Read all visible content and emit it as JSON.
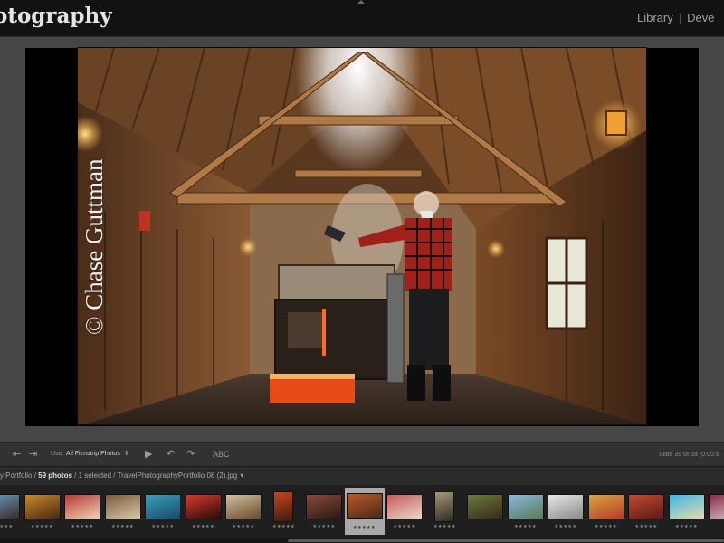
{
  "identity_plate": "otography",
  "modules": [
    {
      "label": "Library"
    },
    {
      "label": "Deve"
    }
  ],
  "slide": {
    "watermark": "© Chase Guttman"
  },
  "toolbar": {
    "use_label": "Use:",
    "use_value": "All Filmstrip Photos",
    "text_tool": "ABC",
    "slide_counter": "Slide 39 of 59 (0:05:5"
  },
  "filmstrip_header": {
    "collection": "phy Portfolio",
    "separator": " / ",
    "photo_count": "59 photos",
    "selection": " / 1 selected / ",
    "filename": "TravelPhotographyPortfolio 08 (2).jpg",
    "dropdown": "▾"
  },
  "filmstrip": {
    "stars": "★★★★★",
    "thumbs": [
      {
        "colors": [
          "#6aa0c8",
          "#3a2a22"
        ],
        "stars": true
      },
      {
        "colors": [
          "#c9882a",
          "#4a2a14"
        ],
        "stars": true
      },
      {
        "colors": [
          "#b53a3a",
          "#f0d0b0"
        ],
        "stars": true
      },
      {
        "colors": [
          "#7a5a3a",
          "#d8c8a8"
        ],
        "stars": true
      },
      {
        "colors": [
          "#3aa0b8",
          "#1a4a6a"
        ],
        "stars": true
      },
      {
        "colors": [
          "#d83a2a",
          "#2a0a0a"
        ],
        "stars": true
      },
      {
        "colors": [
          "#d0c0a0",
          "#6a4a2a"
        ],
        "stars": true
      },
      {
        "colors": [
          "#c8461e",
          "#3a1a10"
        ],
        "stars": true,
        "portrait": true
      },
      {
        "colors": [
          "#8a4a3a",
          "#2a1a14"
        ],
        "stars": true
      },
      {
        "colors": [
          "#b85a2a",
          "#4a2a18"
        ],
        "stars": true,
        "selected": true
      },
      {
        "colors": [
          "#c85a5a",
          "#e8d8c8"
        ],
        "stars": true
      },
      {
        "colors": [
          "#a89878",
          "#2a2a22"
        ],
        "stars": true,
        "portrait": true
      },
      {
        "colors": [
          "#6a7a3a",
          "#3a2a1a"
        ],
        "stars": false
      },
      {
        "colors": [
          "#8ab8d8",
          "#5a7a5a"
        ],
        "stars": true
      },
      {
        "colors": [
          "#e8e8e8",
          "#8a8a8a"
        ],
        "stars": true
      },
      {
        "colors": [
          "#d8a83a",
          "#b83a2a"
        ],
        "stars": true
      },
      {
        "colors": [
          "#c84a2a",
          "#5a1a1a"
        ],
        "stars": true
      },
      {
        "colors": [
          "#3ab8e8",
          "#e8d8a8"
        ],
        "stars": true
      },
      {
        "colors": [
          "#8a2a4a",
          "#d8c8c8"
        ],
        "stars": false
      }
    ]
  }
}
